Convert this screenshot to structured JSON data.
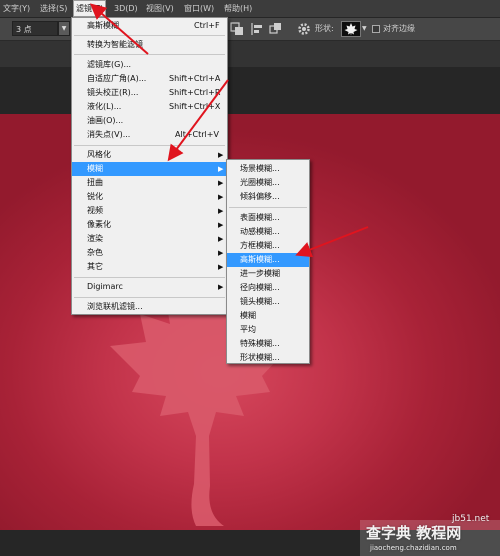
{
  "menubar": {
    "items": [
      {
        "label": "文字(Y)"
      },
      {
        "label": "选择(S)"
      },
      {
        "label": "滤镜(T)"
      },
      {
        "label": "3D(D)"
      },
      {
        "label": "视图(V)"
      },
      {
        "label": "窗口(W)"
      },
      {
        "label": "帮助(H)"
      }
    ]
  },
  "options_bar": {
    "size_value": "3 点",
    "shape_label": "形状:",
    "align_edges_label": "对齐边缘",
    "icons": [
      "pen-tool-icon",
      "path-ops-icon",
      "align-icon",
      "arrange-icon",
      "gear-icon",
      "maple-leaf-shape-icon",
      "dropdown-arrow-icon"
    ]
  },
  "filter_menu": {
    "items": [
      {
        "label": "高斯模糊",
        "shortcut": "Ctrl+F"
      },
      {
        "label": "转换为智能滤镜",
        "shortcut": ""
      },
      {
        "label": "滤镜库(G)...",
        "shortcut": ""
      },
      {
        "label": "自适应广角(A)...",
        "shortcut": "Shift+Ctrl+A"
      },
      {
        "label": "镜头校正(R)...",
        "shortcut": "Shift+Ctrl+R"
      },
      {
        "label": "液化(L)...",
        "shortcut": "Shift+Ctrl+X"
      },
      {
        "label": "油画(O)...",
        "shortcut": ""
      },
      {
        "label": "消失点(V)...",
        "shortcut": "Alt+Ctrl+V"
      },
      {
        "label": "风格化",
        "submenu": true
      },
      {
        "label": "模糊",
        "submenu": true,
        "highlighted": true
      },
      {
        "label": "扭曲",
        "submenu": true
      },
      {
        "label": "锐化",
        "submenu": true
      },
      {
        "label": "视频",
        "submenu": true
      },
      {
        "label": "像素化",
        "submenu": true
      },
      {
        "label": "渲染",
        "submenu": true
      },
      {
        "label": "杂色",
        "submenu": true
      },
      {
        "label": "其它",
        "submenu": true
      },
      {
        "label": "Digimarc",
        "submenu": true
      },
      {
        "label": "浏览联机滤镜..."
      }
    ]
  },
  "blur_submenu": {
    "items": [
      {
        "label": "场景模糊..."
      },
      {
        "label": "光圈模糊..."
      },
      {
        "label": "倾斜偏移..."
      },
      {
        "label": "表面模糊..."
      },
      {
        "label": "动感模糊..."
      },
      {
        "label": "方框模糊..."
      },
      {
        "label": "高斯模糊...",
        "highlighted": true
      },
      {
        "label": "进一步模糊"
      },
      {
        "label": "径向模糊..."
      },
      {
        "label": "镜头模糊..."
      },
      {
        "label": "模糊"
      },
      {
        "label": "平均"
      },
      {
        "label": "特殊模糊..."
      },
      {
        "label": "形状模糊..."
      }
    ]
  },
  "colors": {
    "menu_highlight": "#3399ff",
    "annotation_arrow": "#e0141e",
    "canvas_red": "#c2334a"
  },
  "watermark": {
    "line1": "查字典 教程网",
    "line2": "jb51.net",
    "line3": "jiaocheng.chazidian.com"
  }
}
